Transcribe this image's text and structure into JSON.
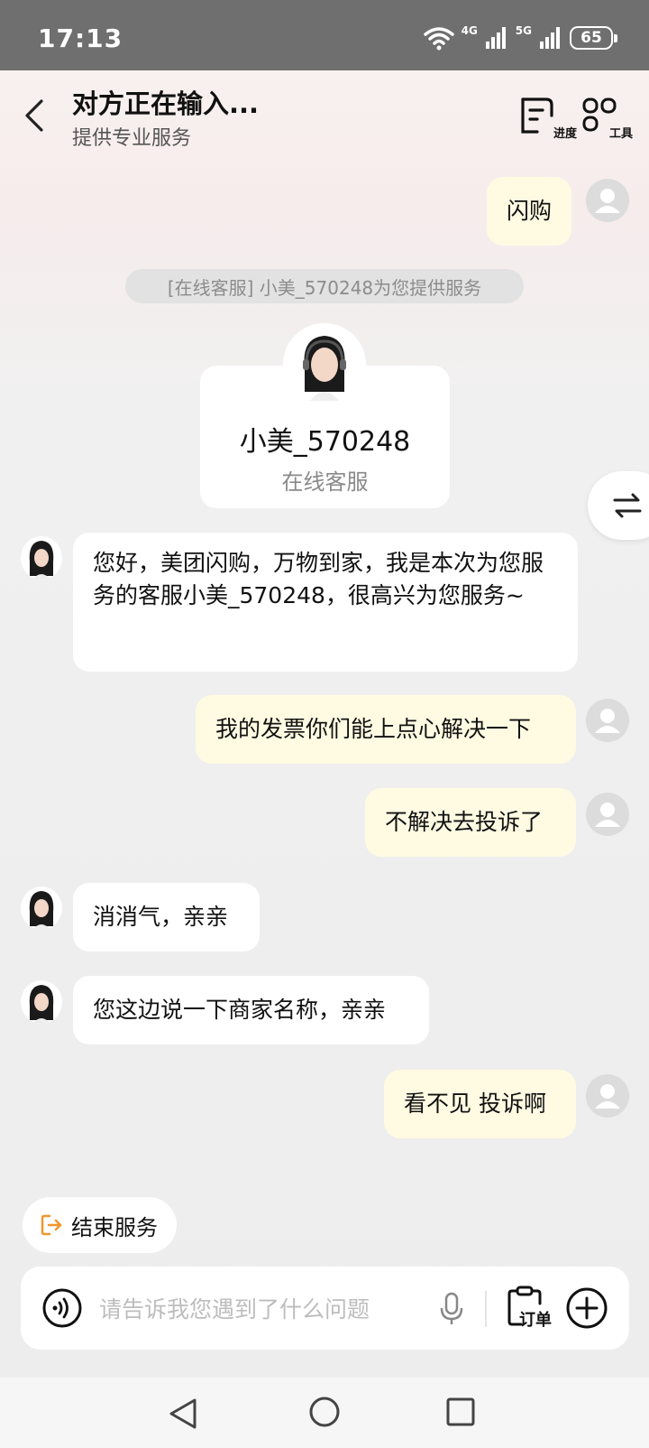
{
  "status_bar": {
    "time": "17:13",
    "network_1": "4G",
    "network_2": "5G",
    "battery": "65"
  },
  "header": {
    "title": "对方正在输入...",
    "subtitle": "提供专业服务",
    "progress_label": "进度",
    "tools_label": "工具"
  },
  "system_notice": "[在线客服] 小美_570248为您提供服务",
  "agent_card": {
    "name": "小美_570248",
    "role": "在线客服"
  },
  "messages": [
    {
      "sender": "user",
      "text": "闪购"
    },
    {
      "sender": "agent",
      "text": "您好，美团闪购，万物到家，我是本次为您服务的客服小美_570248，很高兴为您服务~"
    },
    {
      "sender": "user",
      "text": "我的发票你们能上点心解决一下"
    },
    {
      "sender": "user",
      "text": "不解决去投诉了"
    },
    {
      "sender": "agent",
      "text": "消消气，亲亲"
    },
    {
      "sender": "agent",
      "text": "您这边说一下商家名称，亲亲"
    },
    {
      "sender": "user",
      "text": "看不见 投诉啊"
    }
  ],
  "end_service_label": "结束服务",
  "input": {
    "placeholder": "请告诉我您遇到了什么问题",
    "value": ""
  },
  "order_label": "订单",
  "colors": {
    "user_bubble": "#fffbe3",
    "agent_bubble": "#ffffff",
    "accent_orange": "#f0962e"
  }
}
